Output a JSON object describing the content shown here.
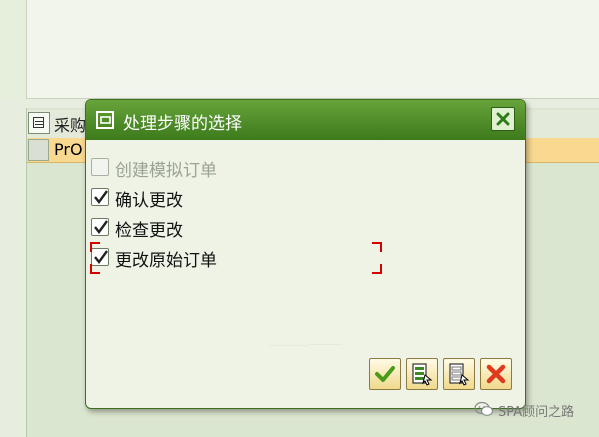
{
  "background": {
    "column_header": "采购",
    "row_cell": "PrO"
  },
  "dialog": {
    "title": "处理步骤的选择",
    "options": [
      {
        "label": "创建模拟订单",
        "checked": false,
        "enabled": false
      },
      {
        "label": "确认更改",
        "checked": true,
        "enabled": true
      },
      {
        "label": "检查更改",
        "checked": true,
        "enabled": true
      },
      {
        "label": "更改原始订单",
        "checked": true,
        "enabled": true,
        "focused": true
      }
    ],
    "buttons": [
      "confirm-icon",
      "select-all-icon",
      "deselect-icon",
      "cancel-icon"
    ]
  },
  "watermark": "SPA顾问之路",
  "colors": {
    "titlebar": "#4a8a27",
    "dialog_bg": "#eef3e6",
    "row_highlight": "#f8d98f",
    "focus_mark": "#d40000"
  }
}
